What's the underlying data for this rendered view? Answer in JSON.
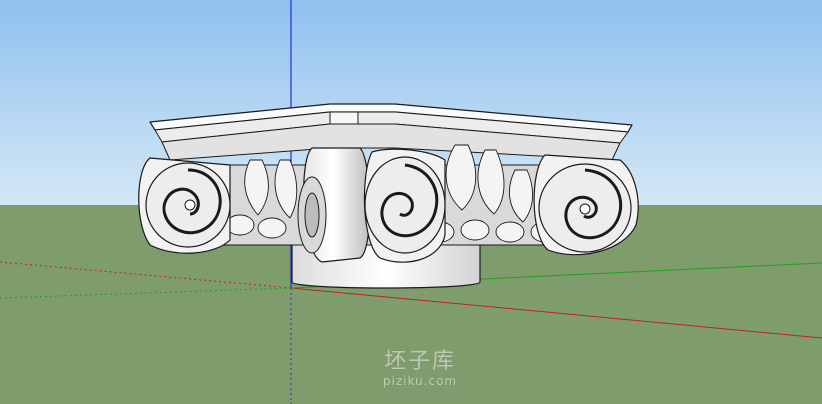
{
  "watermark": {
    "main": "坯子库",
    "sub": "piziku.com"
  },
  "colors": {
    "sky_top": "#8fc0ef",
    "sky_bottom": "#d4e8f6",
    "ground": "#7f9d6c",
    "axis_blue": "#2b2bd6",
    "axis_red": "#c02020",
    "axis_green": "#20a020",
    "model_fill": "#f2f2f2",
    "model_shade": "#c9c9c9",
    "model_line": "#1a1a1a"
  }
}
